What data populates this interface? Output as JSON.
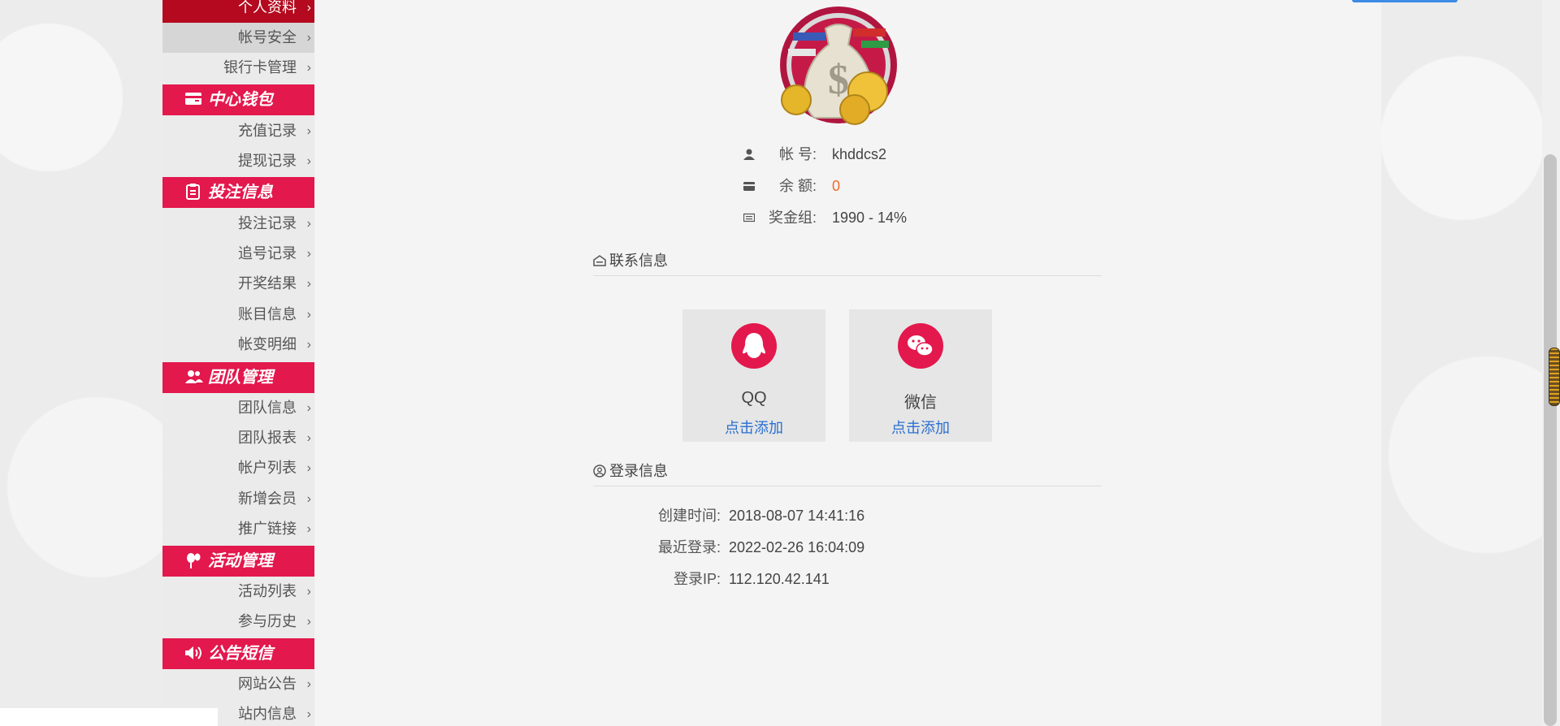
{
  "sidebar": {
    "personal": {
      "items": [
        {
          "label": "个人资料",
          "chevron": "›"
        },
        {
          "label": "帐号安全",
          "chevron": "›"
        },
        {
          "label": "银行卡管理",
          "chevron": "›"
        }
      ]
    },
    "wallet": {
      "title": "中心钱包",
      "icon": "card-icon",
      "items": [
        {
          "label": "充值记录",
          "chevron": "›"
        },
        {
          "label": "提现记录",
          "chevron": "›"
        }
      ]
    },
    "betting": {
      "title": "投注信息",
      "icon": "clipboard-icon",
      "items": [
        {
          "label": "投注记录",
          "chevron": "›"
        },
        {
          "label": "追号记录",
          "chevron": "›"
        },
        {
          "label": "开奖结果",
          "chevron": "›"
        },
        {
          "label": "账目信息",
          "chevron": "›"
        },
        {
          "label": "帐变明细",
          "chevron": "›"
        }
      ]
    },
    "team": {
      "title": "团队管理",
      "icon": "users-icon",
      "items": [
        {
          "label": "团队信息",
          "chevron": "›"
        },
        {
          "label": "团队报表",
          "chevron": "›"
        },
        {
          "label": "帐户列表",
          "chevron": "›"
        },
        {
          "label": "新增会员",
          "chevron": "›"
        },
        {
          "label": "推广链接",
          "chevron": "›"
        }
      ]
    },
    "activity": {
      "title": "活动管理",
      "icon": "balloon-icon",
      "items": [
        {
          "label": "活动列表",
          "chevron": "›"
        },
        {
          "label": "参与历史",
          "chevron": "›"
        }
      ]
    },
    "notice": {
      "title": "公告短信",
      "icon": "speaker-icon",
      "items": [
        {
          "label": "网站公告",
          "chevron": "›"
        },
        {
          "label": "站内信息",
          "chevron": "›"
        }
      ]
    }
  },
  "profile": {
    "account_label": "帐 号:",
    "account_value": "khddcs2",
    "balance_label": "余 额:",
    "balance_value": "0",
    "bonus_label": "奖金组:",
    "bonus_value": "1990 - 14%"
  },
  "contact": {
    "section_title": "联系信息",
    "qq": {
      "name": "QQ",
      "link": "点击添加"
    },
    "wechat": {
      "name": "微信",
      "link": "点击添加"
    }
  },
  "login": {
    "section_title": "登录信息",
    "created_label": "创建时间:",
    "created_value": "2018-08-07 14:41:16",
    "last_label": "最近登录:",
    "last_value": "2022-02-26 16:04:09",
    "ip_label": "登录IP:",
    "ip_value": "112.120.42.141"
  },
  "colors": {
    "accent": "#e3184d",
    "active_dark": "#b4091e",
    "balance": "#f06a2a",
    "link": "#2a6fd1"
  }
}
